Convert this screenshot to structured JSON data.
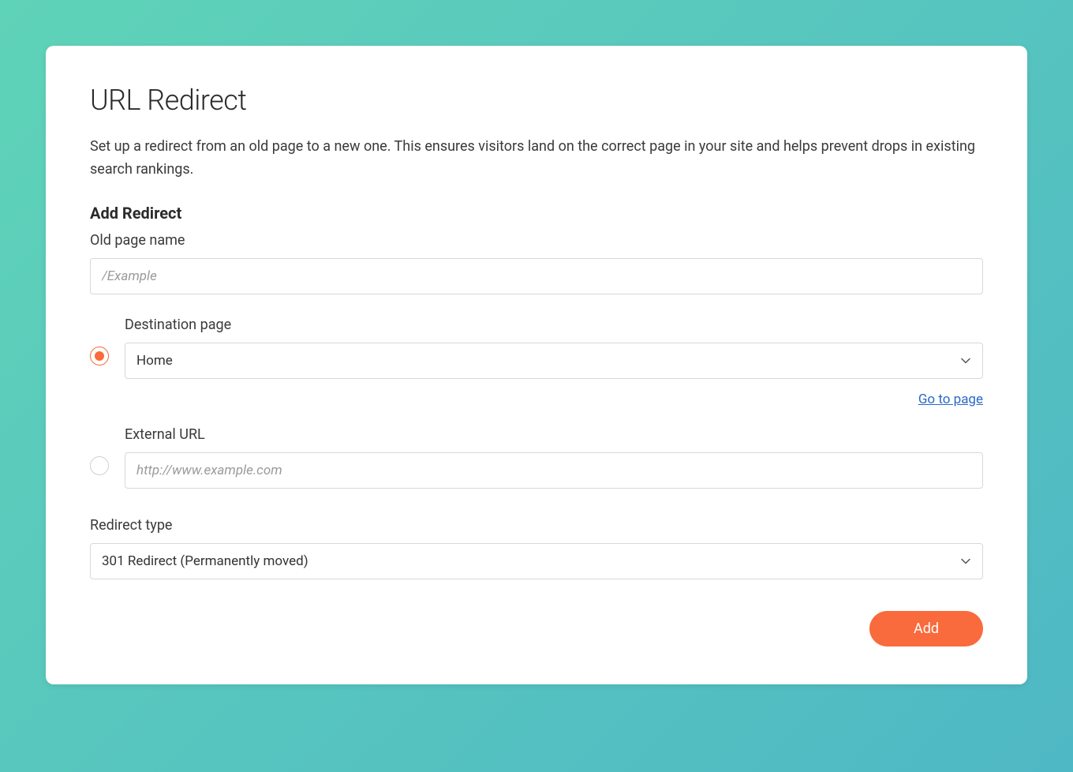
{
  "page": {
    "title": "URL Redirect",
    "description": "Set up a redirect from an old page to a new one. This ensures visitors land on the correct page in your site and helps prevent drops in existing search rankings."
  },
  "form": {
    "section_title": "Add Redirect",
    "old_page": {
      "label": "Old page name",
      "placeholder": "/Example",
      "value": ""
    },
    "destination": {
      "label": "Destination page",
      "selected": "Home",
      "go_to_page_label": "Go to page"
    },
    "external": {
      "label": "External URL",
      "placeholder": "http://www.example.com",
      "value": ""
    },
    "redirect_type": {
      "label": "Redirect type",
      "selected": "301 Redirect (Permanently moved)"
    },
    "add_button_label": "Add"
  }
}
